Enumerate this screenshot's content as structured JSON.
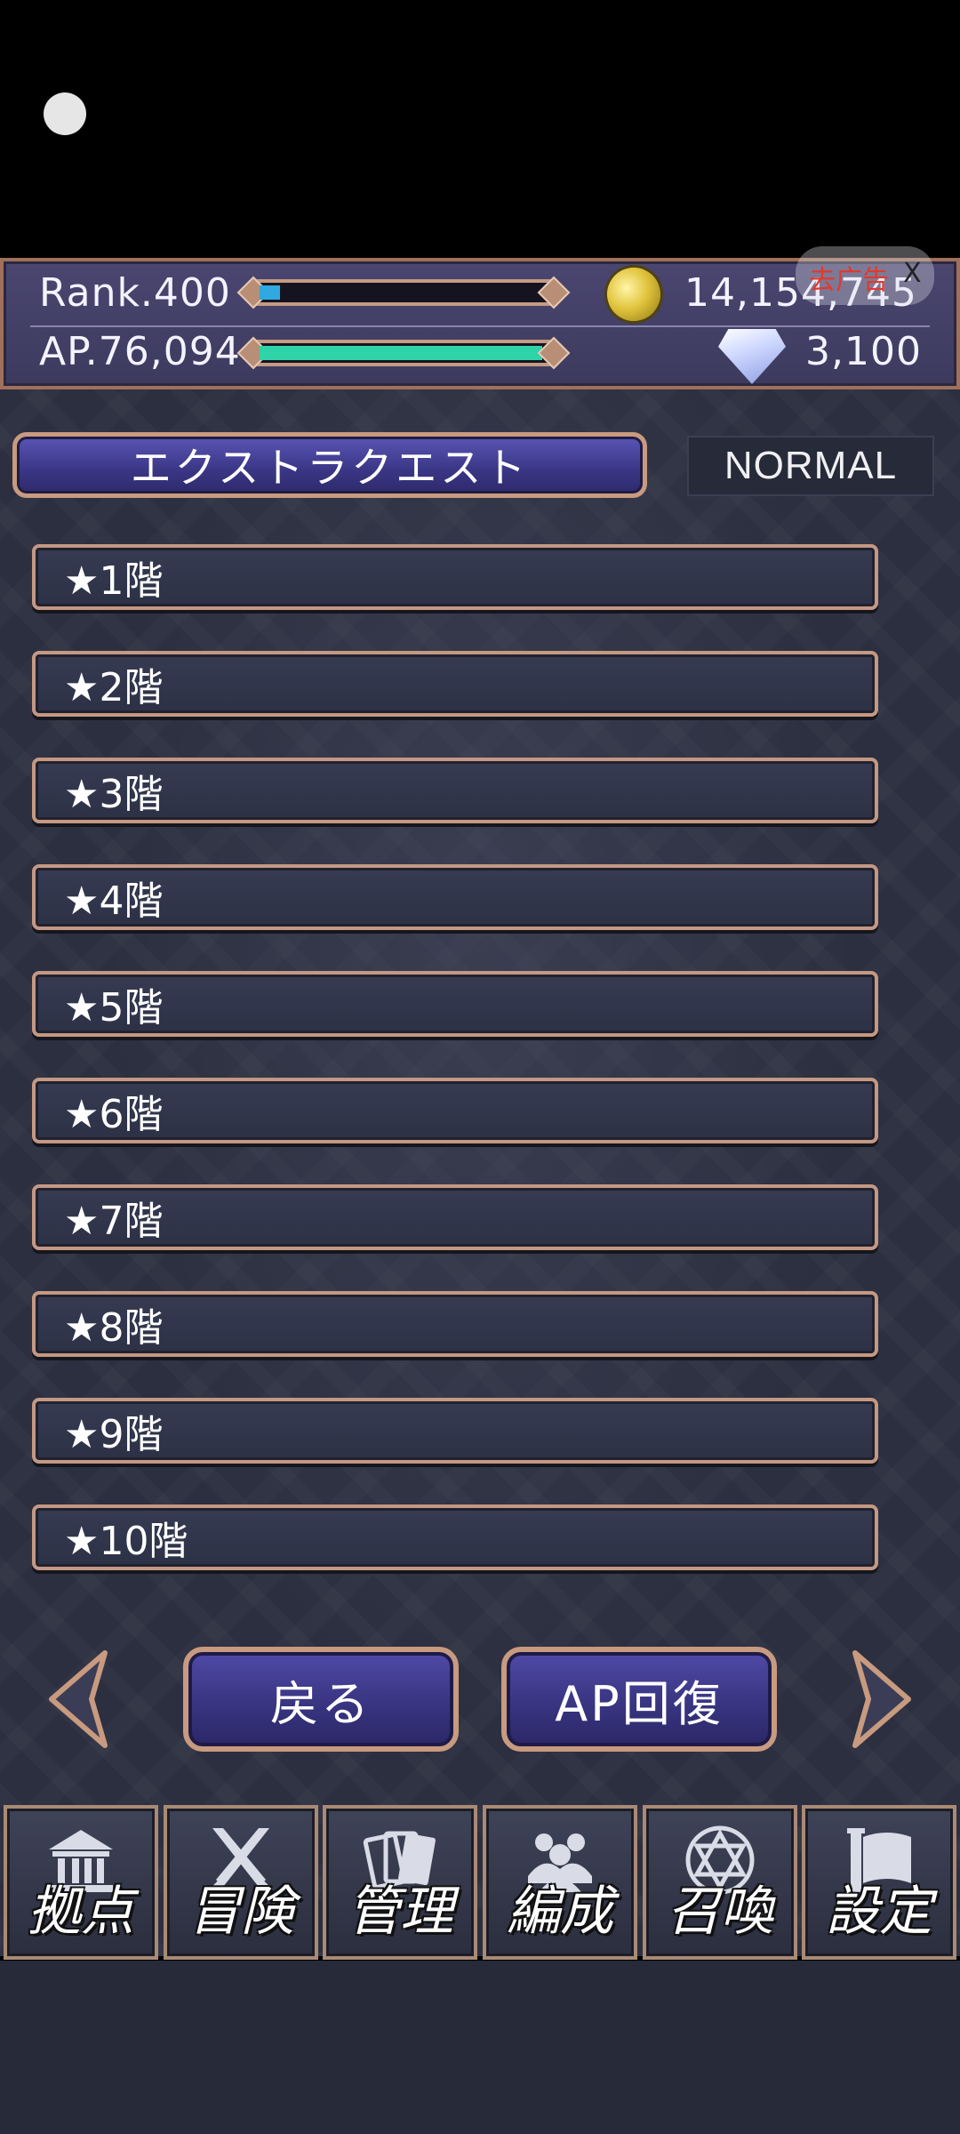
{
  "status": {
    "rank_text": "Rank.400",
    "rank_progress": 0.07,
    "ap_text": "AP.76,094",
    "ap_progress": 0.98,
    "coins": "14,154,745",
    "gems": "3,100",
    "colors": {
      "rank_fill": "#2fa9e0",
      "ap_fill": "#2fd3a8"
    }
  },
  "ad": {
    "label": "去广告",
    "close": "X"
  },
  "header": {
    "quest_title": "エクストラクエスト",
    "difficulty": "NORMAL"
  },
  "floors": [
    {
      "label": "★1階"
    },
    {
      "label": "★2階"
    },
    {
      "label": "★3階"
    },
    {
      "label": "★4階"
    },
    {
      "label": "★5階"
    },
    {
      "label": "★6階"
    },
    {
      "label": "★7階"
    },
    {
      "label": "★8階"
    },
    {
      "label": "★9階"
    },
    {
      "label": "★10階"
    }
  ],
  "nav": {
    "back_label": "戻る",
    "ap_recover_label": "AP回復"
  },
  "menu": [
    {
      "label": "拠点",
      "icon": "building-icon"
    },
    {
      "label": "冒険",
      "icon": "crossed-swords-icon"
    },
    {
      "label": "管理",
      "icon": "cards-icon"
    },
    {
      "label": "編成",
      "icon": "party-icon"
    },
    {
      "label": "召喚",
      "icon": "hexagram-icon"
    },
    {
      "label": "設定",
      "icon": "settings-icon"
    }
  ]
}
